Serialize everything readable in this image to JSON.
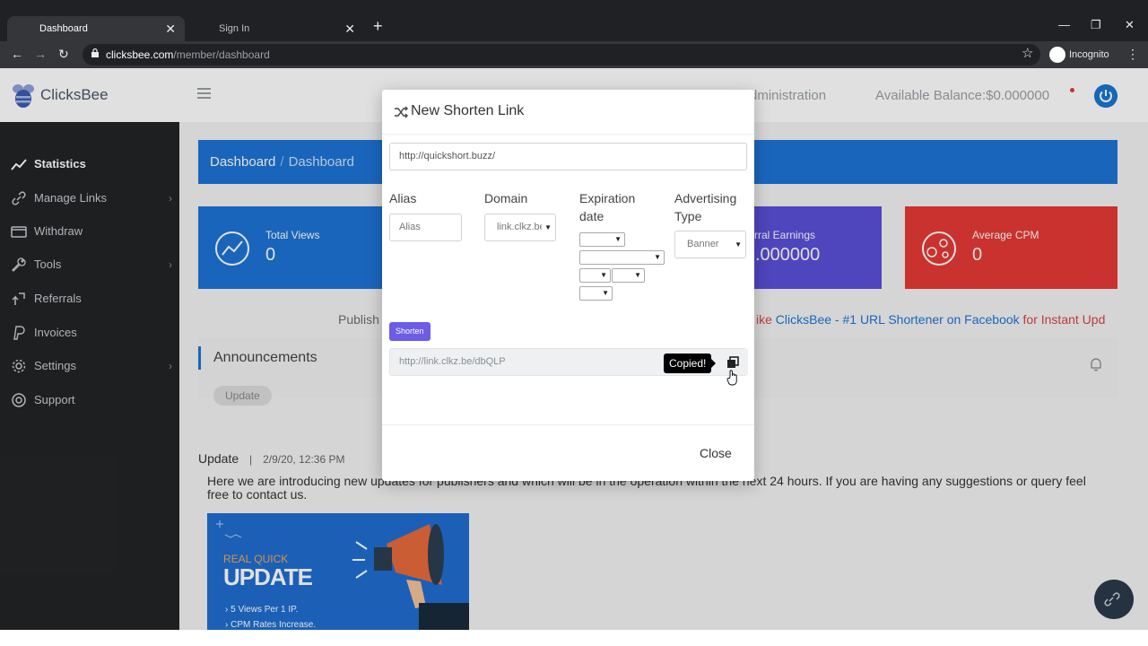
{
  "browser": {
    "tabs": [
      {
        "title": "Dashboard",
        "active": true
      },
      {
        "title": "Sign In",
        "active": false
      }
    ],
    "url_host": "clicksbee.com",
    "url_path": "/member/dashboard",
    "profile_label": "Incognito"
  },
  "app": {
    "brand": "ClicksBee",
    "topnav": {
      "administration": "Administration",
      "balance": "Available Balance:$0.000000"
    },
    "sidebar": [
      {
        "label": "Statistics",
        "icon": "chart-line-icon",
        "has_children": false,
        "active": true
      },
      {
        "label": "Manage Links",
        "icon": "link-icon",
        "has_children": true
      },
      {
        "label": "Withdraw",
        "icon": "wallet-icon",
        "has_children": false
      },
      {
        "label": "Tools",
        "icon": "wrench-icon",
        "has_children": true
      },
      {
        "label": "Referrals",
        "icon": "share-icon",
        "has_children": false
      },
      {
        "label": "Invoices",
        "icon": "paypal-icon",
        "has_children": false
      },
      {
        "label": "Settings",
        "icon": "gear-icon",
        "has_children": true
      },
      {
        "label": "Support",
        "icon": "lifebuoy-icon",
        "has_children": false
      }
    ],
    "breadcrumb": [
      "Dashboard",
      "Dashboard"
    ],
    "stats": [
      {
        "label": "Total Views",
        "value": "0",
        "color": "#1e74d6"
      },
      {
        "label": "rral Earnings",
        "value": ".000000",
        "color": "#5a4fd8"
      },
      {
        "label": "Average CPM",
        "value": "0",
        "color": "#e53935"
      }
    ],
    "publish_text": "Publish",
    "promo": {
      "prefix": "ike ",
      "brand": "ClicksBee - #1 URL Shortener on Facebook",
      "suffix": " for Instant Upd"
    },
    "announcements": {
      "title": "Announcements",
      "badge": "Update"
    },
    "update": {
      "title": "Update",
      "separator": "|",
      "date": "2/9/20, 12:36 PM",
      "body": "Here we are introducing new updates for publishers and which will be in the operation within the next 24 hours. If you are having any suggestions or query feel free to contact us.",
      "banner": {
        "small": "REAL QUICK",
        "big": "UPDATE",
        "lines": [
          "5 Views Per 1 IP.",
          "CPM Rates Increase."
        ]
      }
    }
  },
  "modal": {
    "title": "New Shorten Link",
    "url_value": "http://quickshort.buzz/",
    "alias_label": "Alias",
    "alias_placeholder": "Alias",
    "domain_label": "Domain",
    "domain_value": "link.clkz.be",
    "expiration_label": "Expiration date",
    "ad_type_label": "Advertising Type",
    "ad_type_value": "Banner",
    "shorten_label": "Shorten",
    "result_url": "http://link.clkz.be/dbQLP",
    "copied_tooltip": "Copied!",
    "close_label": "Close"
  },
  "colors": {
    "primary": "#1e74d6",
    "sidebar_bg": "#222426",
    "shorten_button": "#6c5ce7"
  }
}
